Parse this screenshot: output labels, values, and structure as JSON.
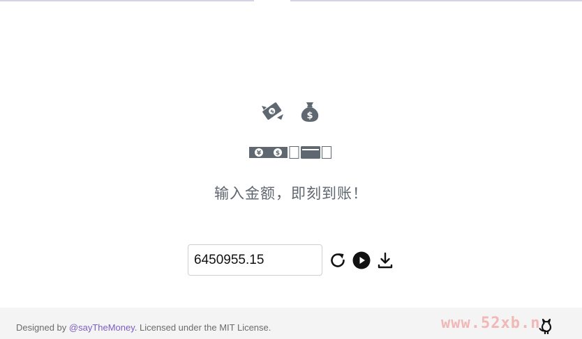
{
  "tagline": "输入金额，即刻到账！",
  "amount": {
    "value": "6450955.15",
    "placeholder": ""
  },
  "footer": {
    "prefix": "Designed by ",
    "author": "@sayTheMoney",
    "suffix": ". Licensed under the MIT License.",
    "watermark": "www.52xb.n"
  },
  "icons": {
    "flying_money": "flying-money-icon",
    "money_bag": "money-bag-icon",
    "money_strip": "yen-dollar-strip-icon",
    "refresh": "refresh-icon",
    "play": "play-icon",
    "download": "download-icon",
    "github": "github-icon"
  },
  "colors": {
    "icon_gray": "#5f6770",
    "link": "#7a5ec4",
    "footer_bg": "#f4f4f4",
    "watermark": "#f2b7b7"
  }
}
